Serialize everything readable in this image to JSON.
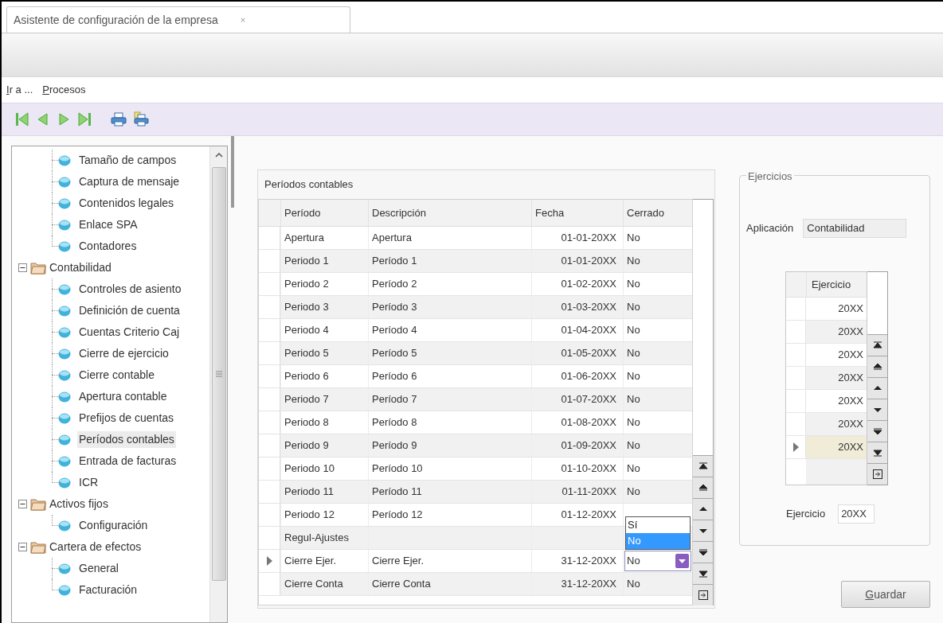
{
  "tab": {
    "title": "Asistente de configuración de la empresa",
    "close": "×"
  },
  "menu": [
    {
      "label": "Ir a ..."
    },
    {
      "label": "Procesos"
    }
  ],
  "tree": {
    "loose_items": [
      {
        "label": "Tamaño de campos",
        "selected": false
      },
      {
        "label": "Captura de mensaje",
        "selected": false
      },
      {
        "label": "Contenidos legales",
        "selected": false
      },
      {
        "label": "Enlace SPA",
        "selected": false
      },
      {
        "label": "Contadores",
        "selected": false
      }
    ],
    "folders": [
      {
        "label": "Contabilidad",
        "expanded": true,
        "children": [
          {
            "label": "Controles de asiento",
            "selected": false
          },
          {
            "label": "Definición de cuenta",
            "selected": false
          },
          {
            "label": "Cuentas Criterio Caj",
            "selected": false
          },
          {
            "label": "Cierre de ejercicio",
            "selected": false
          },
          {
            "label": "Cierre contable",
            "selected": false
          },
          {
            "label": "Apertura contable",
            "selected": false
          },
          {
            "label": "Prefijos de cuentas",
            "selected": false
          },
          {
            "label": "Períodos contables",
            "selected": true
          },
          {
            "label": "Entrada de facturas",
            "selected": false
          },
          {
            "label": "ICR",
            "selected": false
          }
        ]
      },
      {
        "label": "Activos fijos",
        "expanded": true,
        "children": [
          {
            "label": "Configuración",
            "selected": false
          }
        ]
      },
      {
        "label": "Cartera de efectos",
        "expanded": true,
        "children": [
          {
            "label": "General",
            "selected": false
          },
          {
            "label": "Facturación",
            "selected": false
          }
        ]
      }
    ]
  },
  "periods": {
    "title": "Períodos contables",
    "columns": [
      "Período",
      "Descripción",
      "Fecha",
      "Cerrado"
    ],
    "rows": [
      {
        "periodo": "Apertura",
        "descripcion": "Apertura",
        "fecha": "01-01-20XX",
        "cerrado": "No",
        "selected": false
      },
      {
        "periodo": "Periodo 1",
        "descripcion": "Período 1",
        "fecha": "01-01-20XX",
        "cerrado": "No",
        "selected": false
      },
      {
        "periodo": "Periodo 2",
        "descripcion": "Período 2",
        "fecha": "01-02-20XX",
        "cerrado": "No",
        "selected": false
      },
      {
        "periodo": "Periodo 3",
        "descripcion": "Período 3",
        "fecha": "01-03-20XX",
        "cerrado": "No",
        "selected": false
      },
      {
        "periodo": "Periodo 4",
        "descripcion": "Período 4",
        "fecha": "01-04-20XX",
        "cerrado": "No",
        "selected": false
      },
      {
        "periodo": "Periodo 5",
        "descripcion": "Período 5",
        "fecha": "01-05-20XX",
        "cerrado": "No",
        "selected": false
      },
      {
        "periodo": "Periodo 6",
        "descripcion": "Período 6",
        "fecha": "01-06-20XX",
        "cerrado": "No",
        "selected": false
      },
      {
        "periodo": "Periodo 7",
        "descripcion": "Período 7",
        "fecha": "01-07-20XX",
        "cerrado": "No",
        "selected": false
      },
      {
        "periodo": "Periodo 8",
        "descripcion": "Período 8",
        "fecha": "01-08-20XX",
        "cerrado": "No",
        "selected": false
      },
      {
        "periodo": "Periodo 9",
        "descripcion": "Período 9",
        "fecha": "01-09-20XX",
        "cerrado": "No",
        "selected": false
      },
      {
        "periodo": "Periodo 10",
        "descripcion": "Período 10",
        "fecha": "01-10-20XX",
        "cerrado": "No",
        "selected": false
      },
      {
        "periodo": "Periodo 11",
        "descripcion": "Período 11",
        "fecha": "01-11-20XX",
        "cerrado": "No",
        "selected": false
      },
      {
        "periodo": "Periodo 12",
        "descripcion": "Período 12",
        "fecha": "01-12-20XX",
        "selected": false
      },
      {
        "periodo": "Regul-Ajustes",
        "selected": false
      },
      {
        "periodo": "Cierre Ejer.",
        "descripcion": "Cierre Ejer.",
        "fecha": "31-12-20XX",
        "cerrado": "No",
        "selected": true,
        "editor": {
          "options": [
            {
              "label": "Sí",
              "selected": false
            },
            {
              "label": "No",
              "selected": true
            }
          ]
        }
      },
      {
        "periodo": "Cierre Conta",
        "descripcion": "Cierre Conta",
        "fecha": "31-12-20XX",
        "cerrado": "No",
        "selected": false
      }
    ]
  },
  "ejercicios": {
    "title": "Ejercicios",
    "aplicacion_label": "Aplicación",
    "aplicacion": "Contabilidad",
    "grid_header": "Ejercicio",
    "rows": [
      {
        "value": "20XX",
        "selected": false
      },
      {
        "value": "20XX",
        "selected": false
      },
      {
        "value": "20XX",
        "selected": false
      },
      {
        "value": "20XX",
        "selected": false
      },
      {
        "value": "20XX",
        "selected": false
      },
      {
        "value": "20XX",
        "selected": false
      },
      {
        "value": "20XX",
        "selected": true
      }
    ],
    "ejercicio_label": "Ejercicio",
    "ejercicio": "20XX"
  },
  "save_button": "Guardar"
}
